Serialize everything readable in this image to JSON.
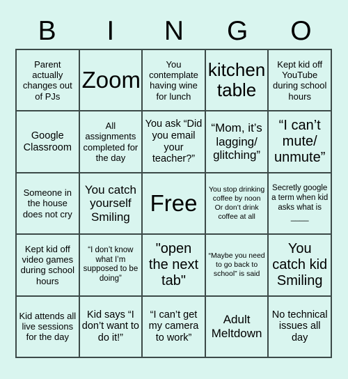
{
  "title": "BINGO",
  "header": {
    "letters": [
      "B",
      "I",
      "N",
      "G",
      "O"
    ]
  },
  "colors": {
    "background": "#d9f5ef",
    "cell_fill": "#d9f5ef",
    "border": "#3c4a48",
    "text": "#000000"
  },
  "grid": {
    "columns": 5,
    "rows": 5,
    "free_space_index": 12
  },
  "cells": [
    {
      "text": "Parent actually changes out of PJs",
      "size": "fs-m"
    },
    {
      "text": "Zoom",
      "size": "fs-4xl"
    },
    {
      "text": "You contemplate having wine for lunch",
      "size": "fs-m"
    },
    {
      "text": "kitchen table",
      "size": "fs-3xl"
    },
    {
      "text": "Kept kid off YouTube during school hours",
      "size": "fs-m"
    },
    {
      "text": "Google Classroom",
      "size": "fs-l"
    },
    {
      "text": "All assignments completed for the day",
      "size": "fs-m"
    },
    {
      "text": "You ask “Did you email your teacher?”",
      "size": "fs-l"
    },
    {
      "text": "“Mom, it’s lagging/ glitching”",
      "size": "fs-xl"
    },
    {
      "text": "“I can’t mute/ unmute”",
      "size": "fs-2xl"
    },
    {
      "text": "Someone in the house does not cry",
      "size": "fs-m"
    },
    {
      "text": "You catch yourself Smiling",
      "size": "fs-xl"
    },
    {
      "text": "Free",
      "size": "fs-4xl"
    },
    {
      "text": "You stop drinking coffee by noon Or don’t drink coffee at all",
      "size": "fs-xs"
    },
    {
      "text": "Secretly google a term when kid asks what is ____",
      "size": "fs-s"
    },
    {
      "text": "Kept kid off video games during school hours",
      "size": "fs-m"
    },
    {
      "text": "“I don’t know what I’m supposed to be doing”",
      "size": "fs-s"
    },
    {
      "text": "\"open the next tab\"",
      "size": "fs-2xl"
    },
    {
      "text": "“Maybe you need to go back to school” is said",
      "size": "fs-xs"
    },
    {
      "text": "You catch kid Smiling",
      "size": "fs-2xl"
    },
    {
      "text": "Kid attends all live sessions for the day",
      "size": "fs-m"
    },
    {
      "text": "Kid says “I don’t want to do it!”",
      "size": "fs-l"
    },
    {
      "text": "“I can’t get my camera to work”",
      "size": "fs-l"
    },
    {
      "text": "Adult Meltdown",
      "size": "fs-xl"
    },
    {
      "text": "No technical issues all day",
      "size": "fs-l"
    }
  ]
}
